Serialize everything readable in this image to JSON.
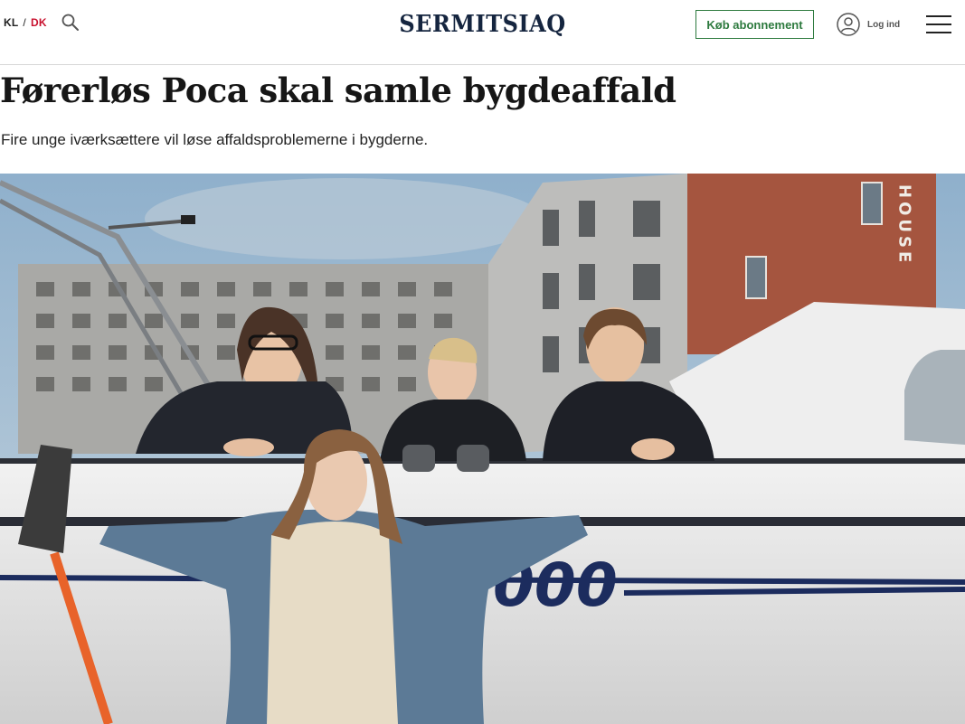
{
  "header": {
    "lang_kl": "KL",
    "lang_sep": "/",
    "lang_dk": "DK",
    "search_icon": "search-icon",
    "logo": "SERMITSIAQ",
    "subscribe_label": "Køb abonnement",
    "login_label": "Log ind",
    "menu_icon": "hamburger-menu-icon"
  },
  "article": {
    "headline": "Førerløs Poca skal samle bygdeaffald",
    "lede": "Fire unge iværksættere vil løse affaldsproblemerne i bygderne.",
    "photo": {
      "hull_text": "000",
      "building_sign": "HOUSE"
    }
  },
  "colors": {
    "brand_navy": "#15253f",
    "accent_green": "#2d7a3e",
    "accent_red": "#c8102e"
  }
}
